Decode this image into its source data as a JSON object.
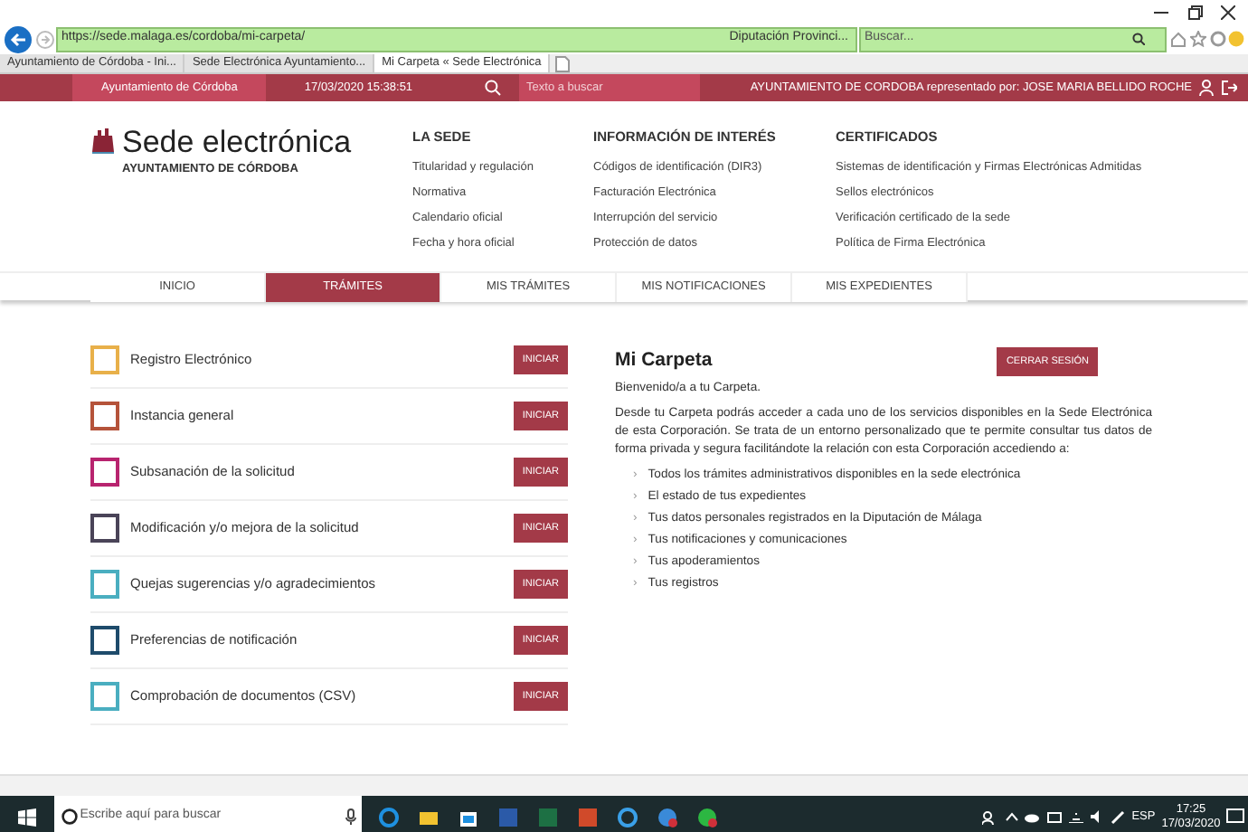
{
  "browser": {
    "url": "https://sede.malaga.es/cordoba/mi-carpeta/",
    "site_identity": "Diputación Provinci...",
    "search_placeholder": "Buscar...",
    "tabs": [
      {
        "label": "Ayuntamiento de Córdoba - Ini...",
        "selected": false
      },
      {
        "label": "Sede Electrónica Ayuntamiento...",
        "selected": false
      },
      {
        "label": "Mi Carpeta « Sede Electrónica",
        "selected": true
      }
    ]
  },
  "top_bar": {
    "site": "Ayuntamiento de Córdoba",
    "datetime": "17/03/2020 15:38:51",
    "search_placeholder": "Texto a buscar",
    "user": "AYUNTAMIENTO DE CORDOBA representado por: JOSE MARIA BELLIDO ROCHE"
  },
  "header": {
    "title": "Sede electrónica",
    "subtitle": "AYUNTAMIENTO DE CÓRDOBA",
    "menus": [
      {
        "heading": "LA SEDE",
        "links": [
          "Titularidad y regulación",
          "Normativa",
          "Calendario oficial",
          "Fecha y hora oficial"
        ]
      },
      {
        "heading": "INFORMACIÓN DE INTERÉS",
        "links": [
          "Códigos de identificación (DIR3)",
          "Facturación Electrónica",
          "Interrupción del servicio",
          "Protección de datos"
        ]
      },
      {
        "heading": "CERTIFICADOS",
        "links": [
          "Sistemas de identificación y Firmas Electrónicas Admitidas",
          "Sellos electrónicos",
          "Verificación certificado de la sede",
          "Política de Firma Electrónica"
        ]
      }
    ]
  },
  "nav": [
    {
      "label": "INICIO",
      "selected": false
    },
    {
      "label": "TRÁMITES",
      "selected": true
    },
    {
      "label": "MIS TRÁMITES",
      "selected": false
    },
    {
      "label": "MIS NOTIFICACIONES",
      "selected": false
    },
    {
      "label": "MIS EXPEDIENTES",
      "selected": false
    }
  ],
  "procedures": [
    {
      "name": "Registro Electrónico",
      "color": "#e8b04a",
      "button": "INICIAR"
    },
    {
      "name": "Instancia general",
      "color": "#b5533a",
      "button": "INICIAR"
    },
    {
      "name": "Subsanación de la solicitud",
      "color": "#b8246f",
      "button": "INICIAR"
    },
    {
      "name": "Modificación y/o mejora de la solicitud",
      "color": "#4a4458",
      "button": "INICIAR"
    },
    {
      "name": "Quejas sugerencias y/o agradecimientos",
      "color": "#4aaec0",
      "button": "INICIAR"
    },
    {
      "name": "Preferencias de notificación",
      "color": "#1e4b6b",
      "button": "INICIAR"
    },
    {
      "name": "Comprobación de documentos (CSV)",
      "color": "#4aaec0",
      "button": "INICIAR"
    }
  ],
  "carpeta": {
    "title": "Mi Carpeta",
    "logout": "CERRAR SESIÓN",
    "welcome": "Bienvenido/a a tu Carpeta.",
    "intro": "Desde tu Carpeta podrás acceder a cada uno de los servicios disponibles en la Sede Electrónica de esta Corporación. Se trata de un entorno personalizado que te permite consultar tus datos de forma privada y segura facilitándote la relación con esta Corporación accediendo a:",
    "bullet": "›",
    "items": [
      "Todos los trámites administrativos disponibles en la sede electrónica",
      "El estado de tus expedientes",
      "Tus datos personales registrados en la Diputación de Málaga",
      "Tus notificaciones y comunicaciones",
      "Tus apoderamientos",
      "Tus registros"
    ]
  },
  "taskbar": {
    "search_placeholder": "Escribe aquí para buscar",
    "language": "ESP",
    "time": "17:25",
    "date": "17/03/2020"
  }
}
